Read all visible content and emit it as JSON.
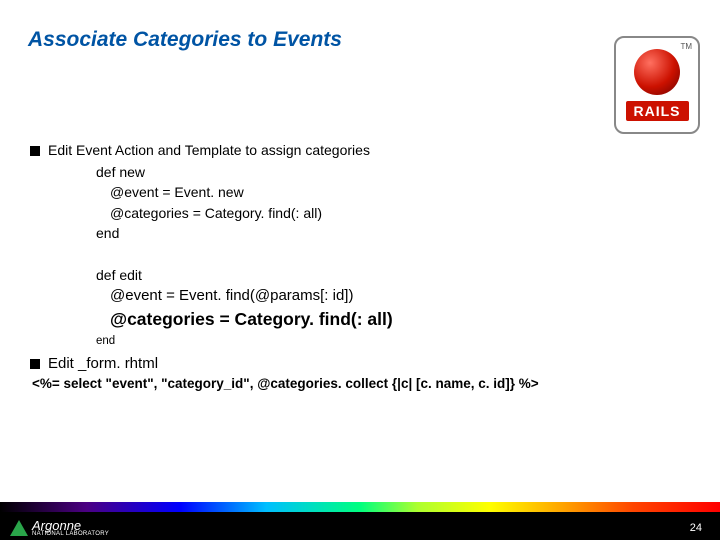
{
  "title": "Associate Categories to Events",
  "logo": {
    "word": "RAILS",
    "tm": "TM"
  },
  "bullets": {
    "b1": "Edit Event Action and Template to assign categories",
    "b2": "Edit _form. rhtml"
  },
  "code_new": {
    "l1": "def new",
    "l2": "@event = Event. new",
    "l3": "@categories = Category. find(: all)",
    "l4": "end"
  },
  "code_edit": {
    "l1": "def edit",
    "l2": "@event = Event. find(@params[: id])",
    "l3": "@categories = Category. find(: all)",
    "l4": "end"
  },
  "erb": "<%= select \"event\", \"category_id\", @categories. collect {|c| [c. name, c. id]} %>",
  "footer": {
    "org": "Argonne",
    "sub": "NATIONAL LABORATORY",
    "page": "24"
  }
}
